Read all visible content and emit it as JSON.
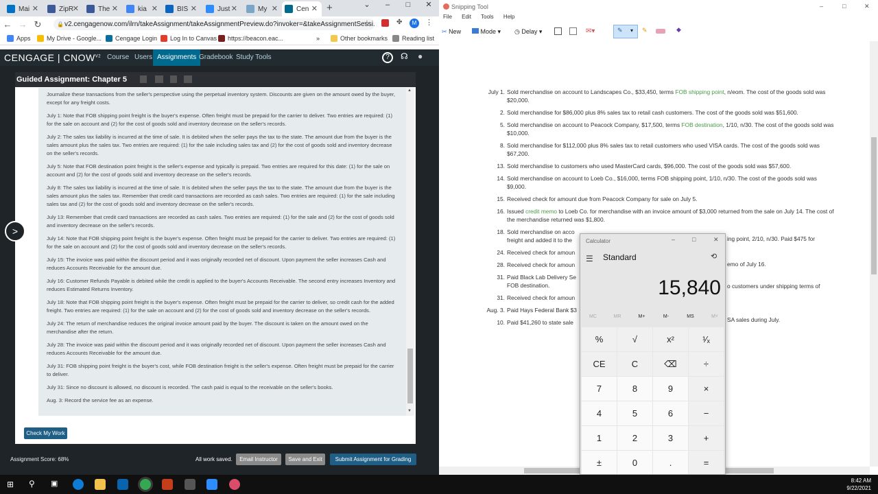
{
  "browser": {
    "tabs": [
      {
        "label": "Mai",
        "color": "#0072c6"
      },
      {
        "label": "ZipR",
        "color": "#3c5a9a"
      },
      {
        "label": "The",
        "color": "#3b5998"
      },
      {
        "label": "kia",
        "color": "#4285f4"
      },
      {
        "label": "BIS",
        "color": "#0a66c2"
      },
      {
        "label": "Just",
        "color": "#2d8cff"
      },
      {
        "label": "My",
        "color": "#7aa7c7"
      },
      {
        "label": "Cen",
        "color": "#006a8e"
      }
    ],
    "url": "v2.cengagenow.com/ilrn/takeAssignment/takeAssignmentPreview.do?invoker=&takeAssignmentSessi...",
    "bookmarks": [
      "Apps",
      "My Drive - Google...",
      "Cengage Login",
      "Log In to Canvas",
      "https://beacon.eac..."
    ],
    "bookmarks_right": [
      "Other bookmarks",
      "Reading list"
    ]
  },
  "cengage": {
    "logo": "CENGAGE | CNOW",
    "logo_sup": "V2",
    "nav": [
      "Course",
      "Users",
      "Assignments",
      "Gradebook",
      "Study Tools"
    ],
    "panel_title": "Guided Assignment: Chapter 5",
    "entries": [
      "Journalize these transactions from the seller's perspective using the perpetual inventory system. Discounts are given on the amount owed by the buyer, except for any freight costs.",
      "July 1: Note that FOB shipping point freight is the buyer's expense. Often freight must be prepaid for the carrier to deliver. Two entries are required: (1) for the sale on account and (2) for the cost of goods sold and inventory decrease on the seller's records.",
      "July 2: The sales tax liability is incurred at the time of sale. It is debited when the seller pays the tax to the state. The amount due from the buyer is the sales amount plus the sales tax. Two entries are required: (1) for the sale including sales tax and (2) for the cost of goods sold and inventory decrease on the seller's records.",
      "July 5: Note that FOB destination point freight is the seller's expense and typically is prepaid. Two entries are required for this date: (1) for the sale on account and (2) for the cost of goods sold and inventory decrease on the seller's records.",
      "July 8: The sales tax liability is incurred at the time of sale. It is debited when the seller pays the tax to the state. The amount due from the buyer is the sales amount plus the sales tax. Remember that credit card transactions are recorded as cash sales. Two entries are required: (1) for the sale including sales tax and (2) for the cost of goods sold and inventory decrease on the seller's records.",
      "July 13: Remember that credit card transactions are recorded as cash sales. Two entries are required: (1) for the sale and (2) for the cost of goods sold and inventory decrease on the seller's records.",
      "July 14: Note that FOB shipping point freight is the buyer's expense. Often freight must be prepaid for the carrier to deliver. Two entries are required: (1) for the sale on account and (2) for the cost of goods sold and inventory decrease on the seller's records.",
      "July 15: The invoice was paid within the discount period and it was originally recorded net of discount. Upon payment the seller increases Cash and reduces Accounts Receivable for the amount due.",
      "July 16: Customer Refunds Payable is debited while the credit is applied to the buyer's Accounts Receivable. The second entry increases Inventory and reduces Estimated Returns Inventory.",
      "July 18: Note that FOB shipping point freight is the buyer's expense. Often freight must be prepaid for the carrier to deliver, so credit cash for the added freight. Two entries are required: (1) for the sale on account and (2) for the cost of goods sold and inventory decrease on the seller's records.",
      "July 24: The return of merchandise reduces the original invoice amount paid by the buyer. The discount is taken on the amount owed on the merchandise after the return.",
      "July 28: The invoice was paid within the discount period and it was originally recorded net of discount. Upon payment the seller increases Cash and reduces Accounts Receivable for the amount due.",
      "July 31: FOB shipping point freight is the buyer's cost, while FOB destination freight is the seller's expense. Often freight must be prepaid for the carrier to deliver.",
      "July 31: Since no discount is allowed, no discount is recorded. The cash paid is equal to the receivable on the seller's books.",
      "Aug. 3: Record the service fee as an expense."
    ],
    "check_button": "Check My Work",
    "score": "Assignment Score: 68%",
    "saved": "All work saved.",
    "btn_email": "Email Instructor",
    "btn_save_exit": "Save and Exit",
    "btn_submit": "Submit Assignment for Grading"
  },
  "snip": {
    "title": "Snipping Tool",
    "menu": [
      "File",
      "Edit",
      "Tools",
      "Help"
    ],
    "tools": {
      "new": "New",
      "mode": "Mode",
      "delay": "Delay"
    },
    "transactions": [
      {
        "date": "July 1.",
        "pre": "Sold merchandise on account to Landscapes Co., $33,450, terms ",
        "link": "FOB shipping point",
        "post": ", n/eom. The cost of the goods sold was $20,000."
      },
      {
        "date": "2.",
        "pre": "Sold merchandise for $86,000 plus 8% sales tax to retail cash customers. The cost of the goods sold was $51,600.",
        "link": "",
        "post": ""
      },
      {
        "date": "5.",
        "pre": "Sold merchandise on account to Peacock Company, $17,500, terms ",
        "link": "FOB destination",
        "post": ", 1/10, n/30. The cost of the goods sold was $10,000."
      },
      {
        "date": "8.",
        "pre": "Sold merchandise for $112,000 plus 8% sales tax to retail customers who used VISA cards. The cost of the goods sold was $67,200.",
        "link": "",
        "post": ""
      },
      {
        "date": "13.",
        "pre": "Sold merchandise to customers who used MasterCard cards, $96,000. The cost of the goods sold was $57,600.",
        "link": "",
        "post": ""
      },
      {
        "date": "14.",
        "pre": "Sold merchandise on account to Loeb Co., $16,000, terms FOB shipping point, 1/10, n/30. The cost of the goods sold was $9,000.",
        "link": "",
        "post": ""
      },
      {
        "date": "15.",
        "pre": "Received check for amount due from Peacock Company for sale on July 5.",
        "link": "",
        "post": ""
      },
      {
        "date": "16.",
        "pre": "Issued ",
        "link": "credit memo",
        "post": " to Loeb Co. for merchandise with an invoice amount of $3,000 returned from the sale on July 14. The cost of the merchandise returned was $1,800."
      },
      {
        "date": "18.",
        "pre": "Sold merchandise on acco",
        "link": "",
        "post": ""
      },
      {
        "date": "24.",
        "pre": "Received check for amoun",
        "link": "",
        "post": ""
      },
      {
        "date": "28.",
        "pre": "Received check for amoun",
        "link": "",
        "post": ""
      },
      {
        "date": "31.",
        "pre": "Paid Black Lab Delivery Se",
        "link": "",
        "post": ""
      },
      {
        "date": "31.",
        "pre": "Received check for amoun",
        "link": "",
        "post": ""
      },
      {
        "date": "Aug. 3.",
        "pre": "Paid Hays Federal Bank $3",
        "link": "",
        "post": ""
      },
      {
        "date": "10.",
        "pre": "Paid $41,260 to state sale",
        "link": "",
        "post": ""
      }
    ],
    "fragments": {
      "r18a": "ing point, 2/10, n/30. Paid $475 for",
      "r18b": "freight and added it to the",
      "r24": "emo of July 16.",
      "r31a": "o customers under shipping terms of",
      "r31b": "FOB destination.",
      "raug": "SA sales during July."
    }
  },
  "calculator": {
    "title": "Calculator",
    "mode": "Standard",
    "display": "15,840",
    "memory": [
      "MC",
      "MR",
      "M+",
      "M-",
      "MS",
      "M˅"
    ],
    "keys": [
      [
        "%",
        "√",
        "x²",
        "¹⁄ₓ"
      ],
      [
        "CE",
        "C",
        "⌫",
        "÷"
      ],
      [
        "7",
        "8",
        "9",
        "×"
      ],
      [
        "4",
        "5",
        "6",
        "−"
      ],
      [
        "1",
        "2",
        "3",
        "+"
      ],
      [
        "±",
        "0",
        ".",
        "="
      ]
    ]
  },
  "taskbar": {
    "time": "8:42 AM",
    "date": "9/22/2021"
  }
}
